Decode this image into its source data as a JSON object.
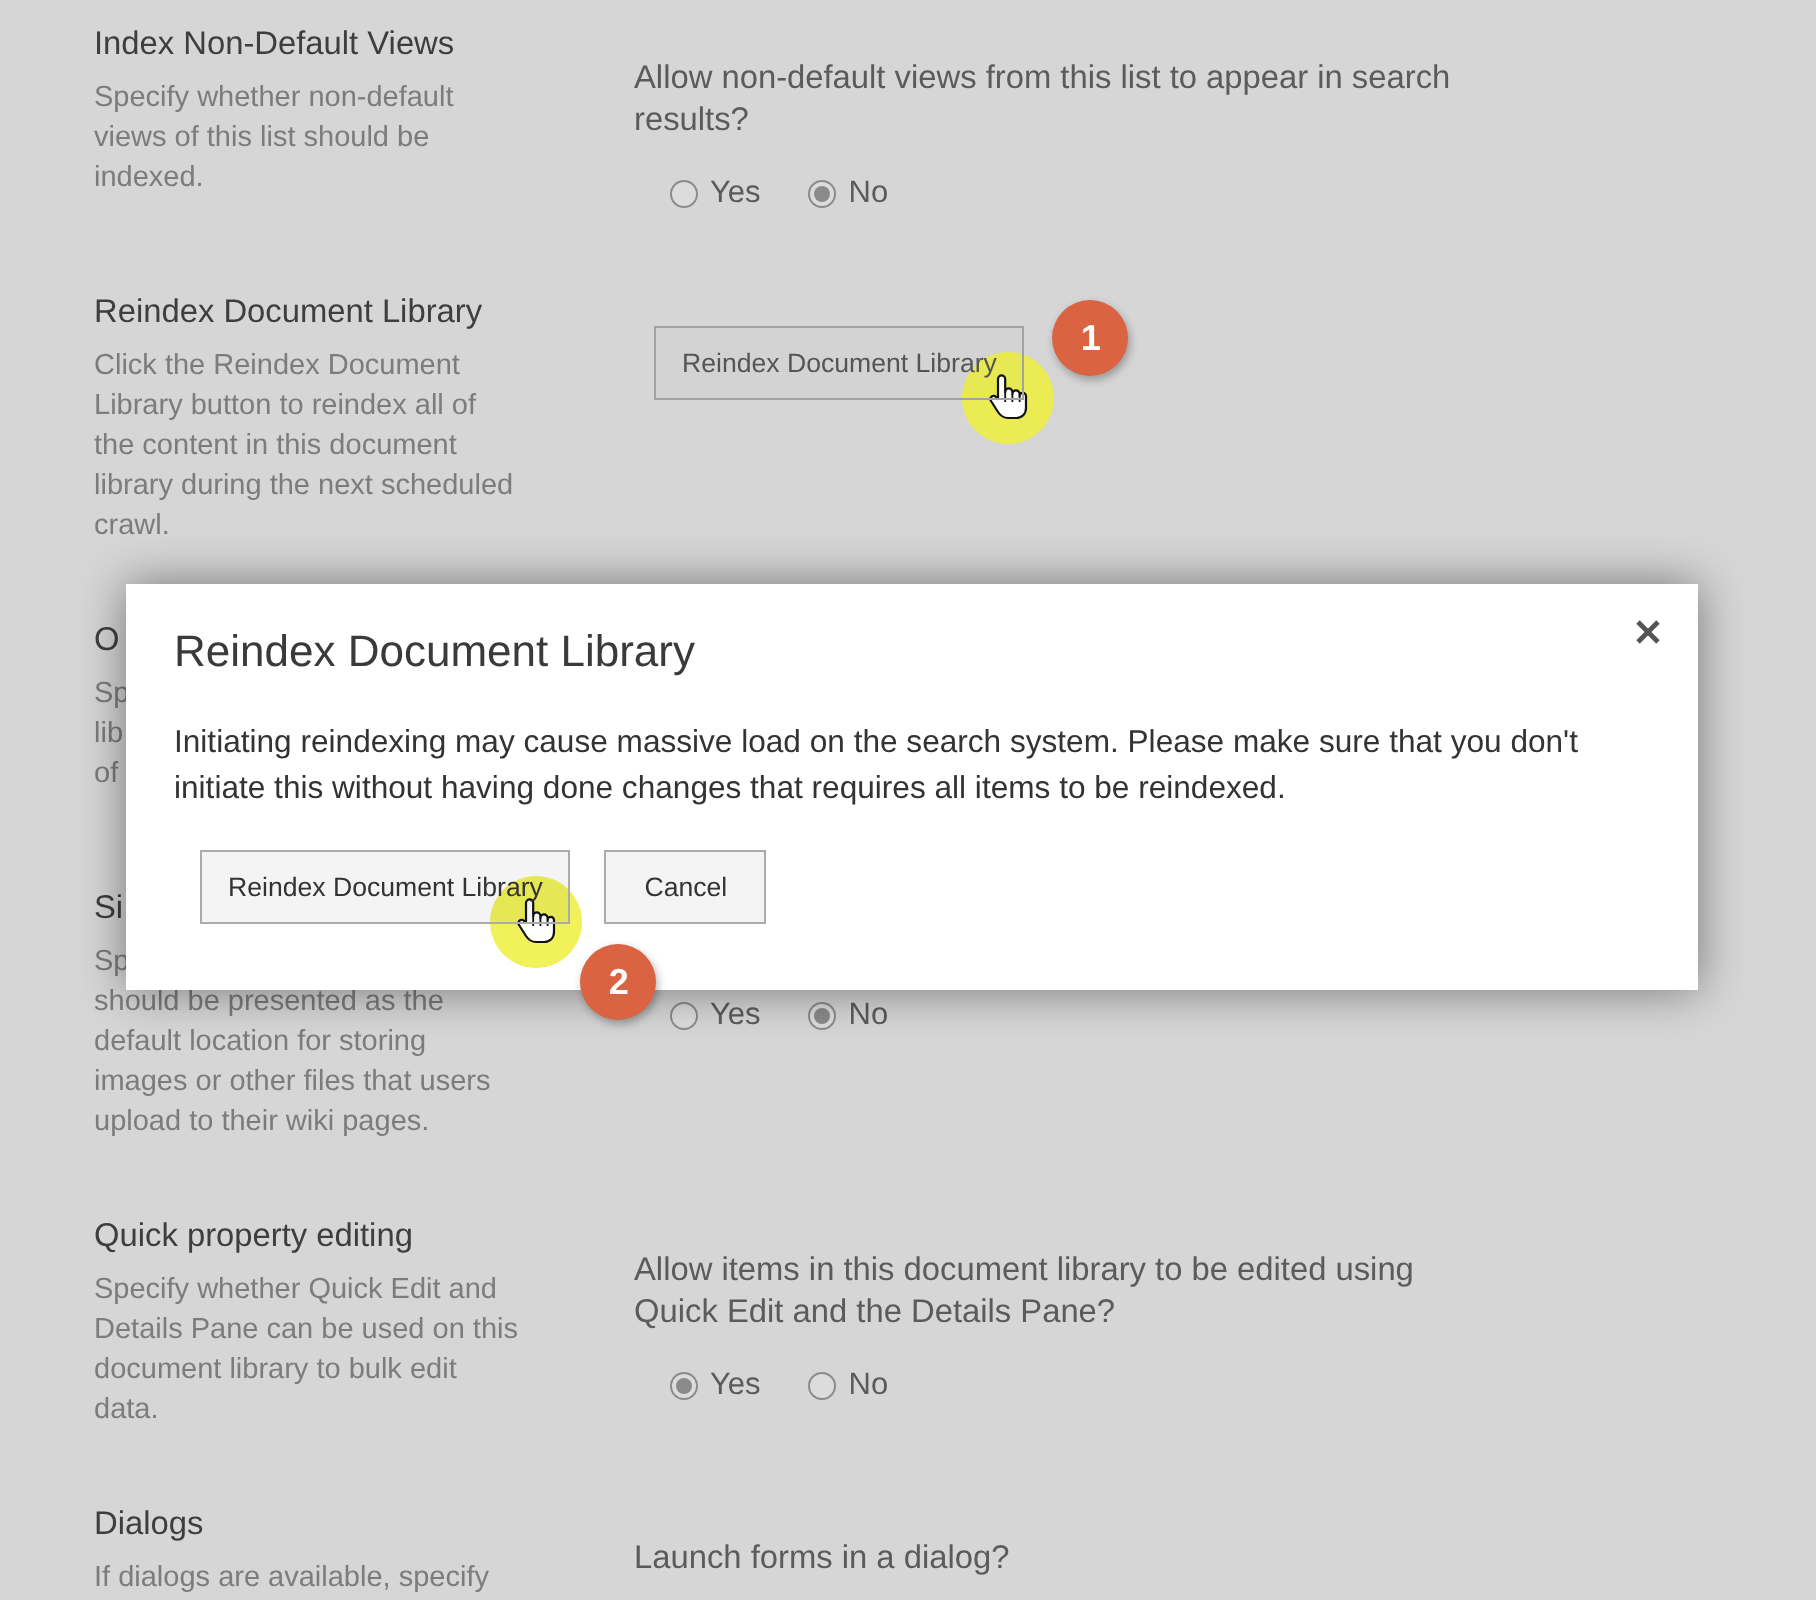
{
  "sections": [
    {
      "title": "Index Non-Default Views",
      "description": [
        "Specify whether non-default",
        "views of this list should be",
        "indexed."
      ],
      "question": "Allow non-default views from this list to appear in search results?",
      "options": [
        {
          "label": "Yes",
          "selected": false
        },
        {
          "label": "No",
          "selected": true
        }
      ]
    },
    {
      "title": "Reindex Document Library",
      "description": [
        "Click the Reindex Document",
        "Library button to reindex all of",
        "the content in this document",
        "library during the next scheduled",
        "crawl."
      ],
      "button": {
        "label": "Reindex Document Library",
        "step": "1"
      }
    },
    {
      "title": "O",
      "description": [
        "Sp",
        "lib",
        "of"
      ]
    },
    {
      "title": "Si",
      "description": [
        "Sp",
        "should be presented as the",
        "default location for storing",
        "images or other files that users",
        "upload to their wiki pages."
      ],
      "options": [
        {
          "label": "Yes",
          "selected": false
        },
        {
          "label": "No",
          "selected": true
        }
      ]
    },
    {
      "title": "Quick property editing",
      "description": [
        "Specify whether Quick Edit and",
        "Details Pane can be used on this",
        "document library to bulk edit",
        "data."
      ],
      "question": "Allow items in this document library to be edited using Quick Edit and the Details Pane?",
      "options": [
        {
          "label": "Yes",
          "selected": true
        },
        {
          "label": "No",
          "selected": false
        }
      ]
    },
    {
      "title": "Dialogs",
      "description": [
        "If dialogs are available, specify"
      ],
      "question": "Launch forms in a dialog?"
    }
  ],
  "dialog": {
    "title": "Reindex Document Library",
    "message": "Initiating reindexing may cause massive load on the search system. Please make sure that you don't initiate this without having done changes that requires all items to be reindexed.",
    "buttons": [
      {
        "label": "Reindex Document Library",
        "step": "2"
      },
      {
        "label": "Cancel"
      }
    ]
  }
}
